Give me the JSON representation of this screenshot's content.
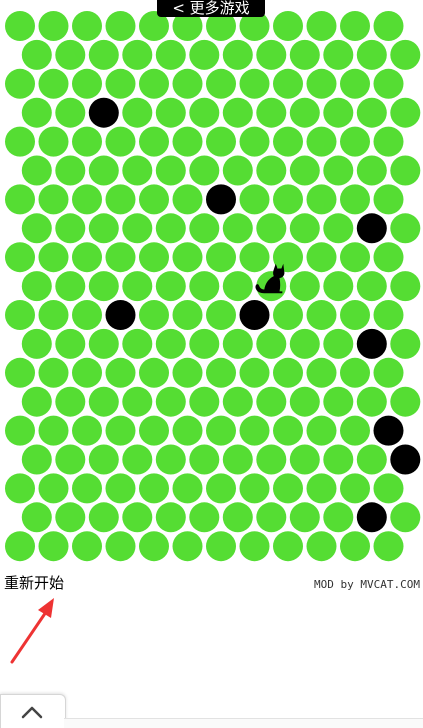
{
  "header": {
    "more_games_label": "< 更多游戏"
  },
  "board": {
    "rows": 19,
    "cols": 12,
    "open_color": "#55dd33",
    "blocked_color": "#000000",
    "blocked_cells": [
      [
        3,
        2
      ],
      [
        6,
        6
      ],
      [
        7,
        10
      ],
      [
        10,
        3
      ],
      [
        10,
        7
      ],
      [
        11,
        10
      ],
      [
        14,
        11
      ],
      [
        15,
        11
      ],
      [
        17,
        10
      ]
    ],
    "cat_cell": [
      9,
      7
    ],
    "cat_icon": "black-cat-icon"
  },
  "footer": {
    "restart_label": "重新开始",
    "watermark": "MOD by MVCAT.COM",
    "arrow_color": "#ee3333",
    "arrow_icon": "red-arrow-icon",
    "scroll_top_icon": "chevron-up-icon"
  }
}
